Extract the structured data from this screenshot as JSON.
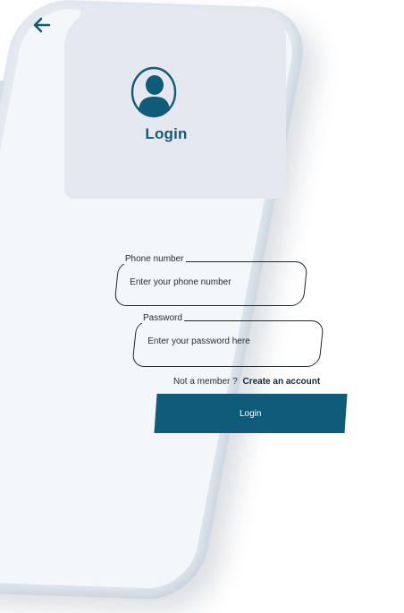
{
  "header": {
    "title": "Login",
    "back_icon": "arrow-left-icon",
    "avatar_icon": "user-avatar-icon"
  },
  "form": {
    "phone": {
      "label": "Phone number",
      "placeholder": "Enter your phone number",
      "value": ""
    },
    "password": {
      "label": "Password",
      "placeholder": "Enter your password here",
      "value": ""
    },
    "signup_prompt": "Not a member ?",
    "signup_link": "Create an account",
    "submit_label": "Login"
  },
  "colors": {
    "brand": "#0e5c79",
    "header_background": "#e6e8ef",
    "screen_background": "#f4f7fa",
    "text": "#1f2a30"
  }
}
